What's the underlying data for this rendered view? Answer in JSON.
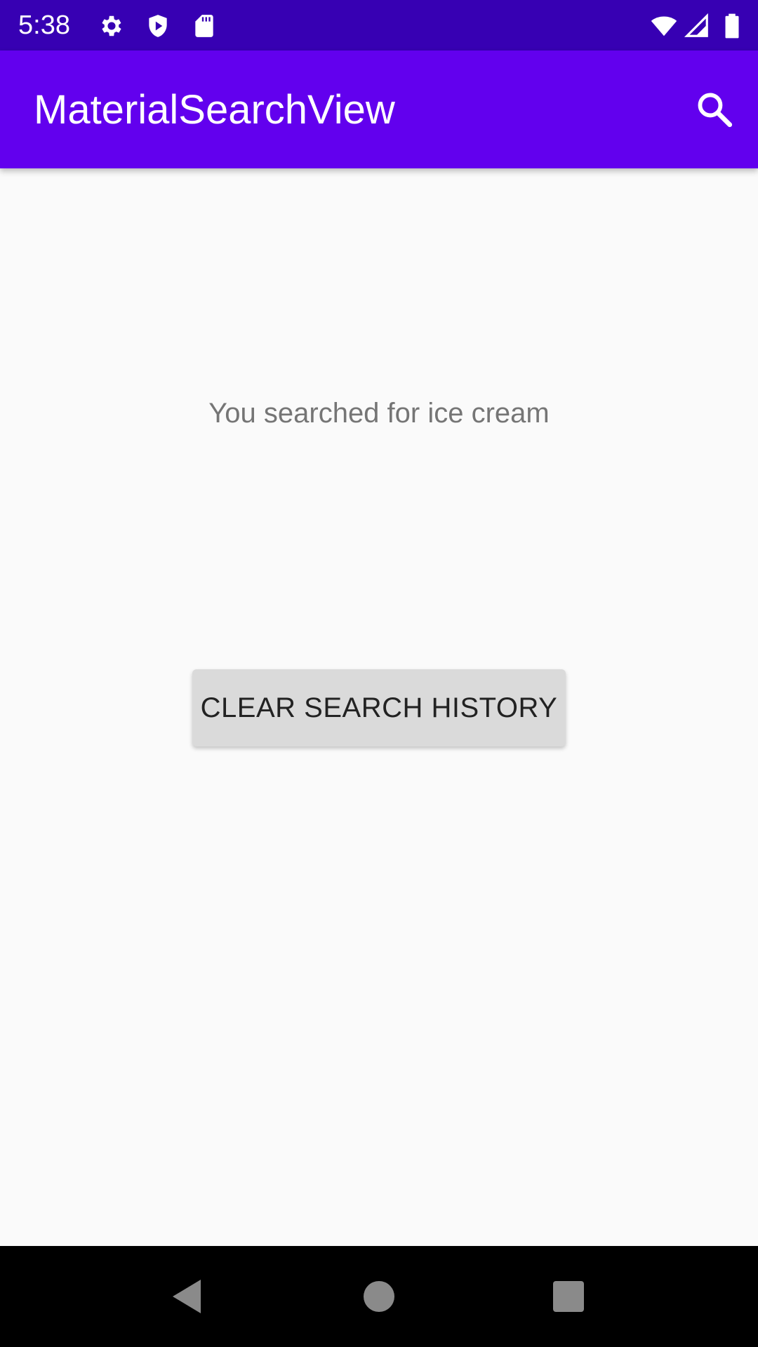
{
  "status_bar": {
    "time": "5:38",
    "icons_left": [
      "settings-icon",
      "shield-play-icon",
      "sd-card-icon"
    ],
    "icons_right": [
      "wifi-icon",
      "signal-icon",
      "battery-icon"
    ]
  },
  "app_bar": {
    "title": "MaterialSearchView",
    "action_icon": "search-icon"
  },
  "content": {
    "result_text": "You searched for ice cream",
    "clear_button_label": "CLEAR SEARCH HISTORY"
  },
  "nav_bar": {
    "buttons": [
      "back-icon",
      "home-icon",
      "recents-icon"
    ]
  },
  "colors": {
    "status_bar": "#3700b3",
    "app_bar": "#6200ee",
    "background": "#fafafa",
    "button": "#dadada"
  }
}
